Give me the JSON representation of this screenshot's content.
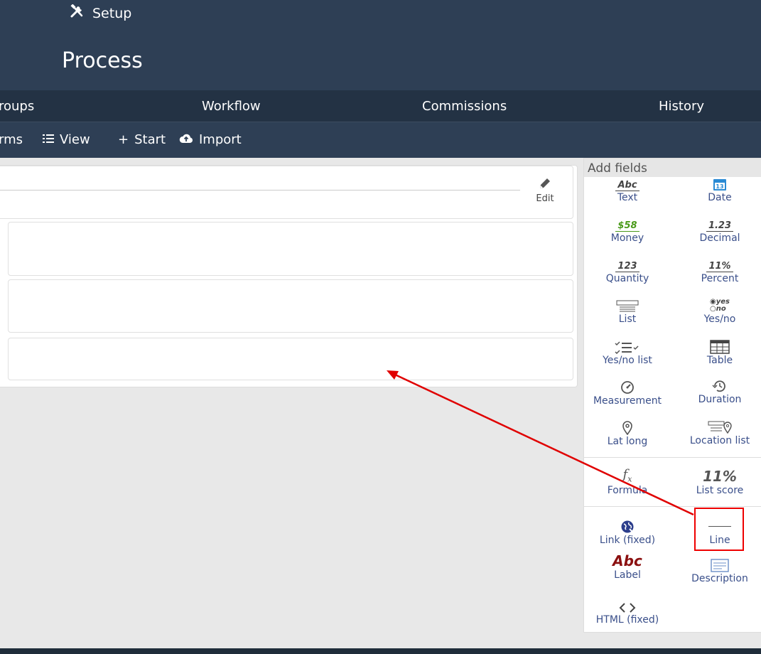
{
  "header": {
    "setup_label": "Setup",
    "page_title": "Process"
  },
  "tabs": [
    {
      "label": "roups"
    },
    {
      "label": "Workflow"
    },
    {
      "label": "Commissions"
    },
    {
      "label": "History"
    }
  ],
  "toolbar": {
    "forms_label": "rms",
    "view_label": "View",
    "start_label": "Start",
    "import_label": "Import"
  },
  "form": {
    "edit_label": "Edit"
  },
  "add_fields": {
    "title": "Add fields",
    "items": [
      {
        "label": "Text",
        "icon": "text-abc-icon"
      },
      {
        "label": "Date",
        "icon": "calendar-icon"
      },
      {
        "label": "Money",
        "icon": "money-icon"
      },
      {
        "label": "Decimal",
        "icon": "decimal-icon"
      },
      {
        "label": "Quantity",
        "icon": "quantity-icon"
      },
      {
        "label": "Percent",
        "icon": "percent-icon"
      },
      {
        "label": "List",
        "icon": "list-icon"
      },
      {
        "label": "Yes/no",
        "icon": "yes-no-icon"
      },
      {
        "label": "Yes/no list",
        "icon": "yes-no-list-icon"
      },
      {
        "label": "Table",
        "icon": "table-icon"
      },
      {
        "label": "Measurement",
        "icon": "gauge-icon"
      },
      {
        "label": "Duration",
        "icon": "clock-icon"
      },
      {
        "label": "Lat long",
        "icon": "map-pin-icon"
      },
      {
        "label": "Location list",
        "icon": "location-list-icon"
      },
      {
        "label": "Formula",
        "icon": "formula-icon"
      },
      {
        "label": "List score",
        "icon": "list-score-icon"
      },
      {
        "label": "Link (fixed)",
        "icon": "globe-link-icon"
      },
      {
        "label": "Line",
        "icon": "line-icon"
      },
      {
        "label": "Label",
        "icon": "label-abc-icon"
      },
      {
        "label": "Description",
        "icon": "description-icon"
      },
      {
        "label": "HTML (fixed)",
        "icon": "code-icon"
      }
    ],
    "icon_text": {
      "abc": "Abc",
      "money": "$58",
      "decimal": "1.23",
      "quantity": "123",
      "percent": "11%",
      "yes": "yes",
      "no": "no",
      "list_score": "11%",
      "label_abc": "Abc",
      "date_day": "13"
    }
  },
  "colors": {
    "header_bg": "#2e3f55",
    "tabs_bg": "#233244",
    "field_label": "#3a4f8a",
    "money_green": "#4a9a1a",
    "label_red": "#8b1010",
    "annotation_red": "#e00000"
  }
}
